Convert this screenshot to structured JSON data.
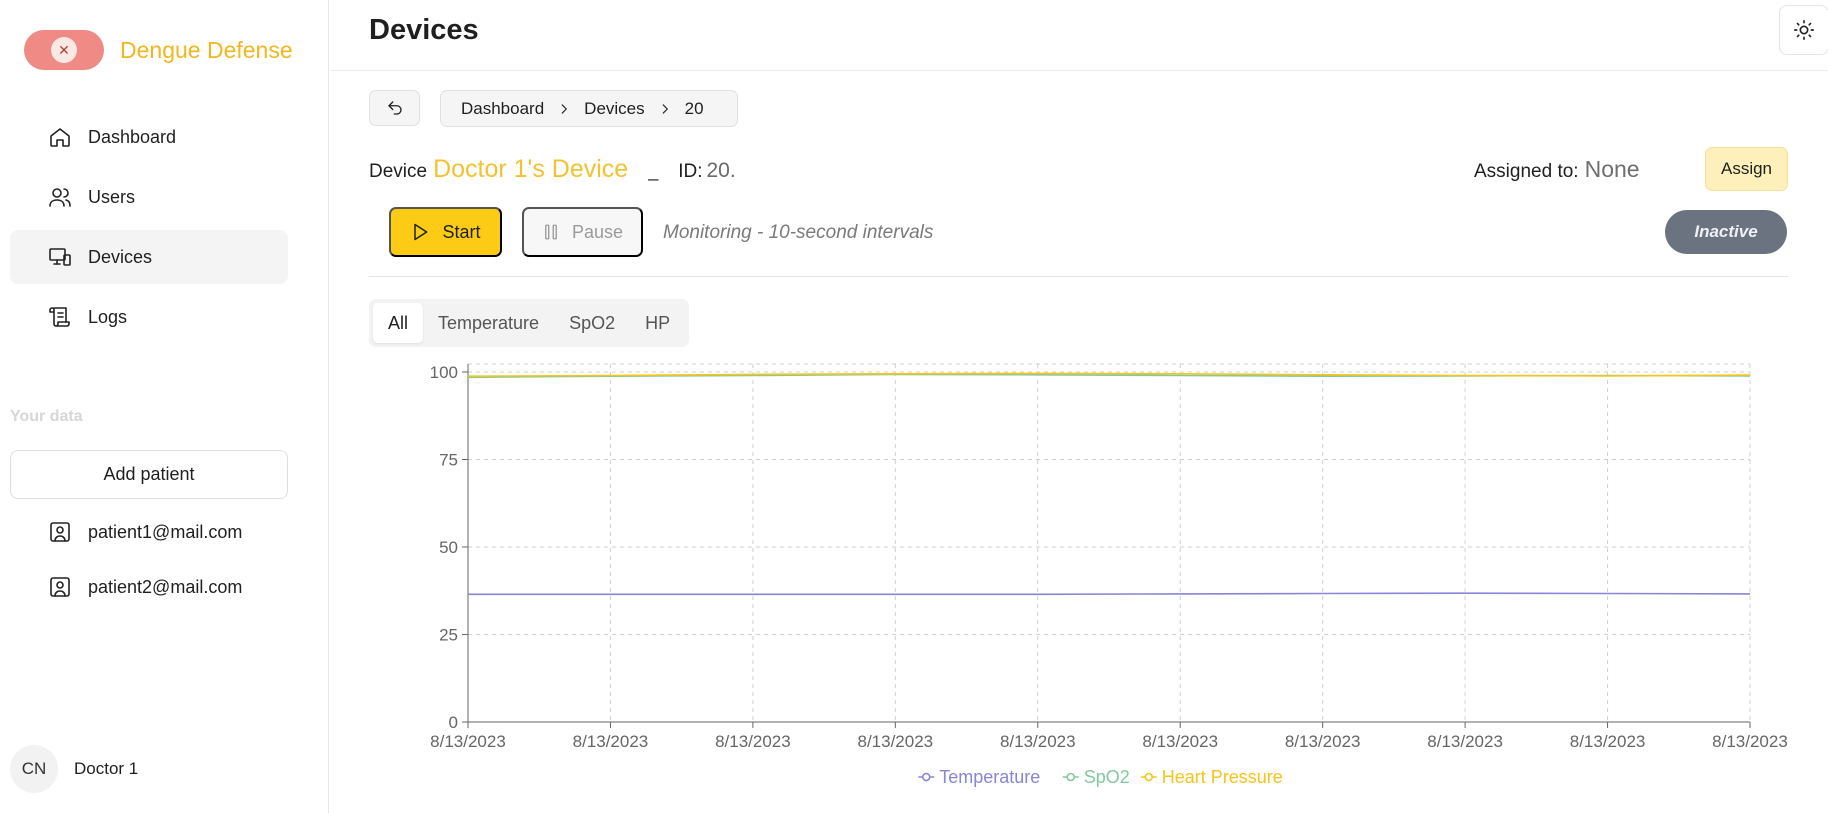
{
  "brand": {
    "name": "Dengue Defense"
  },
  "nav": {
    "items": [
      {
        "label": "Dashboard",
        "icon": "home-icon",
        "active": false
      },
      {
        "label": "Users",
        "icon": "users-icon",
        "active": false
      },
      {
        "label": "Devices",
        "icon": "devices-icon",
        "active": true
      },
      {
        "label": "Logs",
        "icon": "scroll-icon",
        "active": false
      }
    ]
  },
  "your_data": {
    "label": "Your data",
    "add_patient": "Add patient",
    "patients": [
      "patient1@mail.com",
      "patient2@mail.com"
    ]
  },
  "user": {
    "initials": "CN",
    "name": "Doctor 1"
  },
  "page": {
    "title": "Devices"
  },
  "breadcrumb": [
    "Dashboard",
    "Devices",
    "20"
  ],
  "device": {
    "prefix": "Device",
    "name": "Doctor 1's Device",
    "separator": "_",
    "id_label": "ID:",
    "id_value": "20.",
    "assigned_label": "Assigned to:",
    "assigned_value": "None",
    "assign_button": "Assign"
  },
  "controls": {
    "start": "Start",
    "pause": "Pause",
    "monitoring_text": "Monitoring - 10-second intervals",
    "status": "Inactive"
  },
  "tabs": [
    {
      "label": "All",
      "active": true
    },
    {
      "label": "Temperature",
      "active": false
    },
    {
      "label": "SpO2",
      "active": false
    },
    {
      "label": "HP",
      "active": false
    }
  ],
  "colors": {
    "accent": "#fbcb15",
    "brand_text": "#f3b61f",
    "temperature": "#8884d8",
    "spo2": "#82ca9d",
    "heart_pressure": "#f5c518",
    "status_inactive": "#6b7280"
  },
  "chart_data": {
    "type": "line",
    "x": [
      "8/13/2023",
      "8/13/2023",
      "8/13/2023",
      "8/13/2023",
      "8/13/2023",
      "8/13/2023",
      "8/13/2023",
      "8/13/2023",
      "8/13/2023",
      "8/13/2023"
    ],
    "yticks": [
      "0",
      "25",
      "50",
      "75",
      "100"
    ],
    "ylim": [
      0,
      100
    ],
    "grid": true,
    "legend_position": "bottom-center",
    "series": [
      {
        "name": "Temperature",
        "color": "#8884d8",
        "values": [
          36.5,
          36.5,
          36.5,
          36.5,
          36.5,
          36.6,
          36.7,
          36.8,
          36.7,
          36.6
        ]
      },
      {
        "name": "SpO2",
        "color": "#82ca9d",
        "values": [
          98.5,
          98.8,
          99.0,
          99.3,
          99.2,
          99.0,
          98.8,
          98.9,
          99.0,
          98.9
        ]
      },
      {
        "name": "Heart Pressure",
        "color": "#f5c518",
        "values": [
          98.8,
          99.0,
          99.3,
          99.5,
          99.6,
          99.5,
          99.2,
          99.0,
          98.9,
          99.1
        ]
      }
    ]
  }
}
